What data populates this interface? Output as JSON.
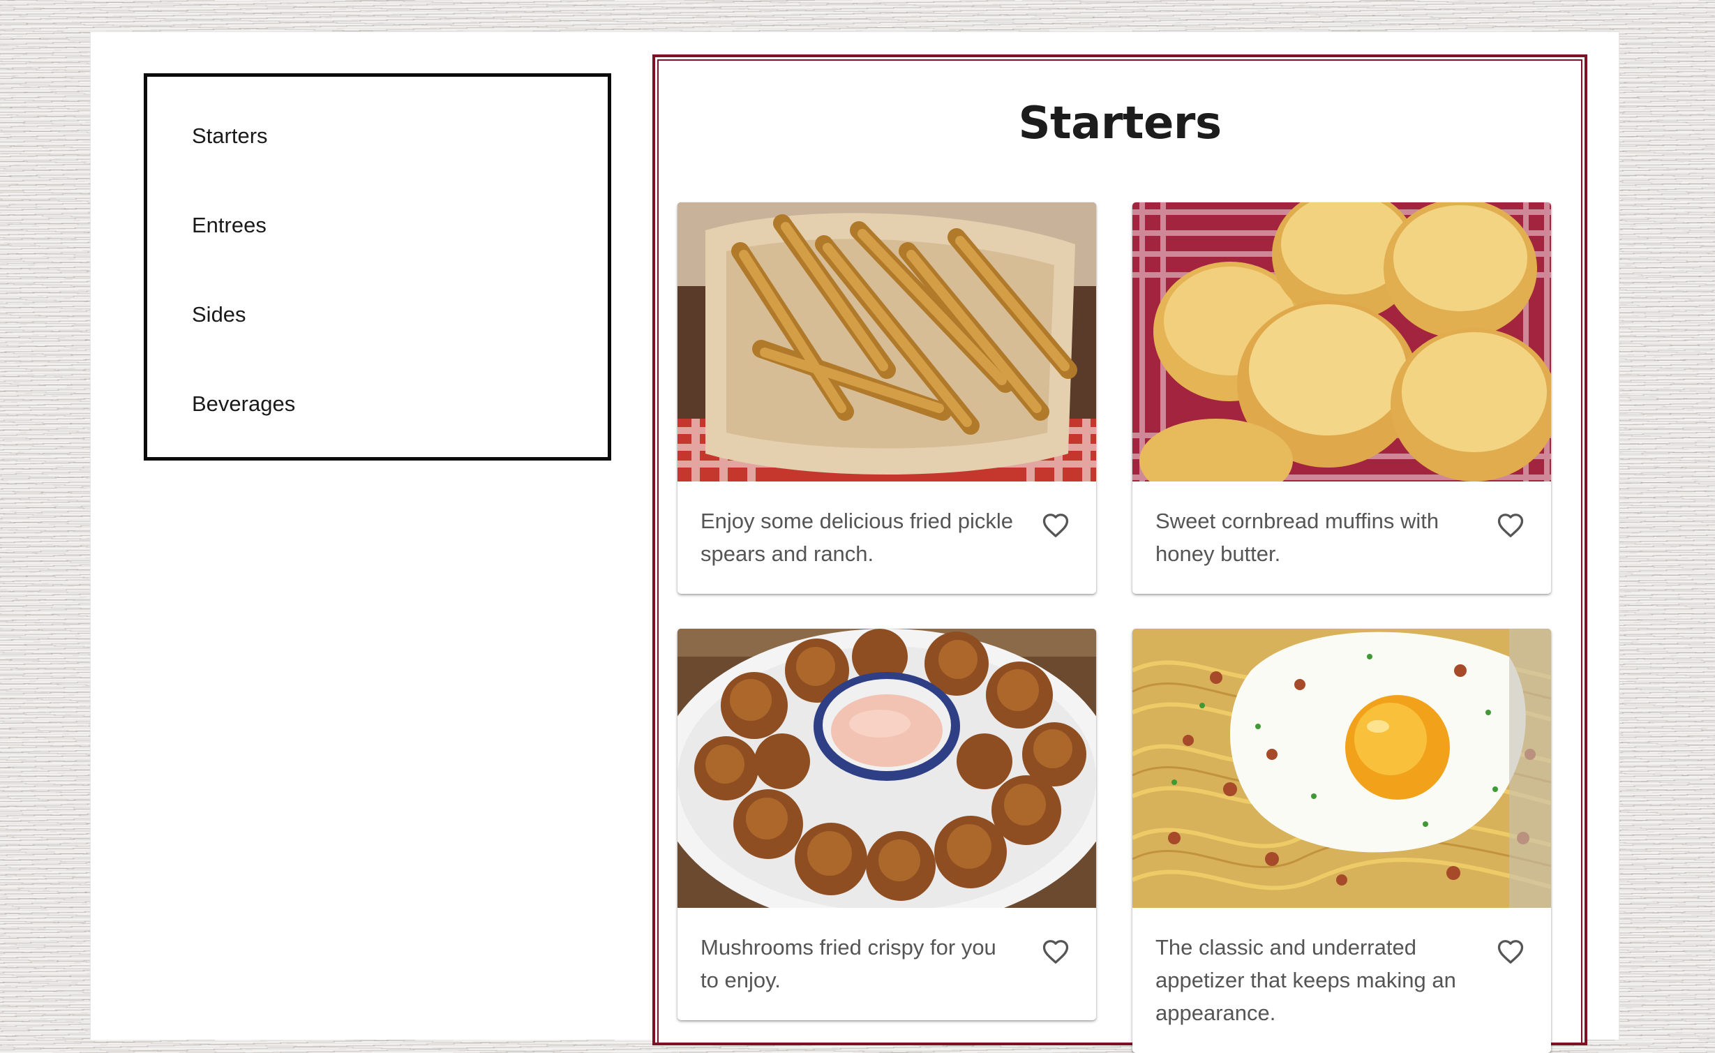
{
  "nav": {
    "items": [
      {
        "label": "Starters"
      },
      {
        "label": "Entrees"
      },
      {
        "label": "Sides"
      },
      {
        "label": "Beverages"
      }
    ]
  },
  "section": {
    "title": "Starters",
    "cards": [
      {
        "description": "Enjoy some delicious fried pickle spears and ranch.",
        "image": "fried-pickles-photo",
        "icon": "heart-outline-icon"
      },
      {
        "description": "Sweet cornbread muffins with honey butter.",
        "image": "cornbread-muffins-photo",
        "icon": "heart-outline-icon"
      },
      {
        "description": "Mushrooms fried crispy for you to enjoy.",
        "image": "fried-mushrooms-photo",
        "icon": "heart-outline-icon"
      },
      {
        "description": "The classic and underrated appetizer that keeps making an appearance.",
        "image": "pasta-with-fried-egg-photo",
        "icon": "heart-outline-icon"
      }
    ]
  },
  "colors": {
    "frame": "#7d1226",
    "nav_border": "#0b0b0b",
    "text_muted": "#555555"
  }
}
